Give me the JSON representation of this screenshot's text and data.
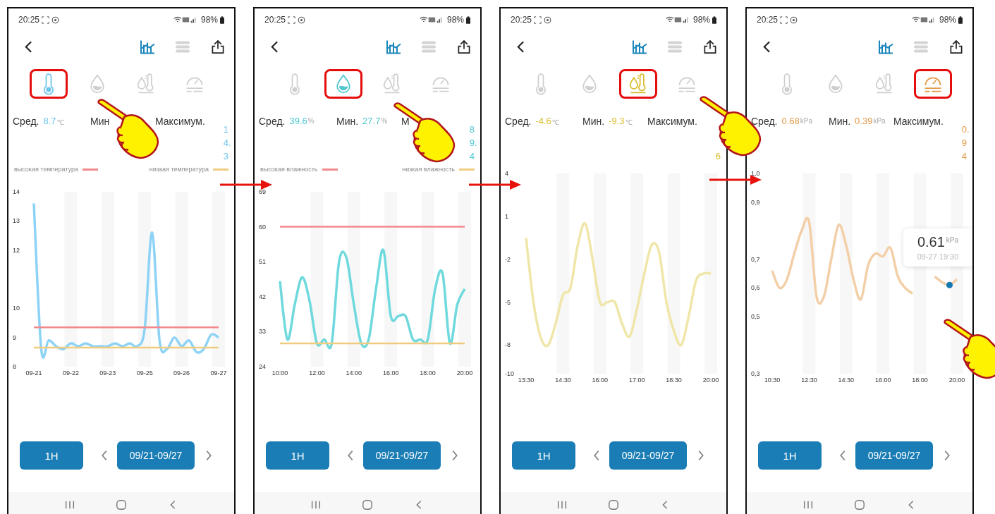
{
  "panels": [
    {
      "color": "#6cc4ec",
      "status_bar": {
        "time": "20:25",
        "battery": "98%"
      },
      "views": [
        {
          "selected": true
        },
        {
          "selected": false
        }
      ],
      "tabs": [
        {
          "selected": true
        },
        {
          "selected": false
        },
        {
          "selected": false
        },
        {
          "selected": false
        }
      ],
      "stats": [
        {
          "kind": "inline",
          "label": "Сред.",
          "value": "8.7",
          "unit": "℃"
        },
        {
          "kind": "inline",
          "label": "Мин"
        },
        {
          "kind": "column",
          "label": "Максимум.",
          "value": "14.3"
        }
      ],
      "chart_data": {
        "type": "line",
        "categories": [
          "09-21",
          null,
          null,
          null,
          null,
          "09-22",
          null,
          null,
          null,
          null,
          "09-23",
          null,
          null,
          null,
          null,
          "09-25",
          null,
          null,
          null,
          null,
          "09-26",
          null,
          null,
          null,
          null,
          "09-27"
        ],
        "yticks": [
          8,
          9,
          10,
          12,
          13,
          14
        ],
        "ylim": [
          8,
          14
        ],
        "series": [
          {
            "color": "#8dd3f6",
            "values": [
              13.6,
              8.6,
              8.9,
              8.7,
              8.6,
              8.8,
              8.7,
              8.8,
              8.7,
              8.7,
              8.7,
              8.8,
              8.7,
              8.8,
              8.7,
              9.3,
              12.6,
              8.9,
              8.6,
              9.0,
              8.7,
              8.9,
              8.5,
              8.6,
              9.1,
              9.0
            ]
          },
          {
            "name": "высокая температура",
            "color": "#f2898c",
            "values": [
              9.35,
              9.35,
              9.35,
              9.35,
              9.35,
              9.35,
              9.35,
              9.35,
              9.35,
              9.35,
              9.35,
              9.35,
              9.35,
              9.35,
              9.35,
              9.35,
              9.35,
              9.35,
              9.35,
              9.35,
              9.35,
              9.35,
              9.35,
              9.35,
              9.35,
              9.35
            ]
          },
          {
            "name": "низкая температура",
            "color": "#f0cc80",
            "values": [
              8.65,
              8.65,
              8.65,
              8.65,
              8.65,
              8.65,
              8.65,
              8.65,
              8.65,
              8.65,
              8.65,
              8.65,
              8.65,
              8.65,
              8.65,
              8.65,
              8.65,
              8.65,
              8.65,
              8.65,
              8.65,
              8.65,
              8.65,
              8.65,
              8.65,
              8.65
            ]
          }
        ]
      },
      "period_button": "1H",
      "date_range": "09/21-09/27"
    },
    {
      "color": "#4fc6cf",
      "status_bar": {
        "time": "20:25",
        "battery": "98%"
      },
      "views": [
        {
          "selected": true
        },
        {
          "selected": false
        }
      ],
      "tabs": [
        {
          "selected": false
        },
        {
          "selected": true
        },
        {
          "selected": false
        },
        {
          "selected": false
        }
      ],
      "stats": [
        {
          "kind": "inline",
          "label": "Сред.",
          "value": "39.6",
          "unit": "%"
        },
        {
          "kind": "inline",
          "label": "Мин.",
          "value": "27.7",
          "unit": "%"
        },
        {
          "kind": "column",
          "label": "М",
          "value": "89.4"
        }
      ],
      "chart_data": {
        "type": "line",
        "categories": [
          "10:00",
          null,
          null,
          null,
          null,
          "12:00",
          null,
          null,
          null,
          null,
          "14:00",
          null,
          null,
          null,
          null,
          "16:00",
          null,
          null,
          null,
          null,
          "18:00",
          null,
          null,
          null,
          null,
          "20:00"
        ],
        "yticks": [
          24,
          33,
          42,
          51,
          60,
          69
        ],
        "ylim": [
          24,
          69
        ],
        "series": [
          {
            "color": "#6fd9dd",
            "values": [
              46,
              31,
              40,
              47,
              41,
              30,
              31,
              30,
              51,
              52,
              40,
              30,
              31,
              44,
              54,
              37,
              37,
              37,
              31,
              31,
              31,
              44,
              48,
              30,
              40,
              44
            ]
          },
          {
            "name": "высокая влажность",
            "color": "#f2898c",
            "values": [
              60,
              60,
              60,
              60,
              60,
              60,
              60,
              60,
              60,
              60,
              60,
              60,
              60,
              60,
              60,
              60,
              60,
              60,
              60,
              60,
              60,
              60,
              60,
              60,
              60,
              60
            ]
          },
          {
            "name": "низкая влажность",
            "color": "#f0cc80",
            "values": [
              30,
              30,
              30,
              30,
              30,
              30,
              30,
              30,
              30,
              30,
              30,
              30,
              30,
              30,
              30,
              30,
              30,
              30,
              30,
              30,
              30,
              30,
              30,
              30,
              30,
              30
            ]
          }
        ]
      },
      "period_button": "1H",
      "date_range": "09/21-09/27"
    },
    {
      "color": "#d9bd2f",
      "status_bar": {
        "time": "20:25",
        "battery": "98%"
      },
      "views": [
        {
          "selected": true
        },
        {
          "selected": false
        }
      ],
      "tabs": [
        {
          "selected": false
        },
        {
          "selected": false
        },
        {
          "selected": true
        },
        {
          "selected": false
        }
      ],
      "stats": [
        {
          "kind": "inline",
          "label": "Сред.",
          "value": "-4.6",
          "unit": "℃"
        },
        {
          "kind": "inline",
          "label": "Мин.",
          "value": "-9.3",
          "unit": "℃"
        },
        {
          "kind": "column",
          "label": "Максимум.",
          "value": "6"
        }
      ],
      "chart_data": {
        "type": "line",
        "categories": [
          "13:30",
          null,
          null,
          null,
          null,
          "14:30",
          null,
          null,
          null,
          null,
          "16:00",
          null,
          null,
          null,
          null,
          "17:00",
          null,
          null,
          null,
          null,
          "18:30",
          null,
          null,
          null,
          null,
          "20:00"
        ],
        "yticks": [
          -10,
          -8,
          -5,
          -2,
          1,
          4
        ],
        "ylim": [
          -10,
          4
        ],
        "series": [
          {
            "color": "#efe6a8",
            "values": [
              -0.5,
              -5,
              -7.5,
              -8,
              -6.5,
              -4.5,
              -4,
              -1,
              0.5,
              -2,
              -5,
              -5,
              -5,
              -6.5,
              -7.4,
              -5.5,
              -3,
              -1,
              -1.5,
              -5,
              -7,
              -8,
              -6,
              -3.5,
              -3,
              -3
            ]
          }
        ]
      },
      "period_button": "1H",
      "date_range": "09/21-09/27"
    },
    {
      "color": "#e39a48",
      "status_bar": {
        "time": "20:25",
        "battery": "98%"
      },
      "views": [
        {
          "selected": true
        },
        {
          "selected": false
        }
      ],
      "tabs": [
        {
          "selected": false
        },
        {
          "selected": false
        },
        {
          "selected": false
        },
        {
          "selected": true
        }
      ],
      "stats": [
        {
          "kind": "inline",
          "label": "Сред.",
          "value": "0.68",
          "unit": "kPa"
        },
        {
          "kind": "inline",
          "label": "Мин.",
          "value": "0.39",
          "unit": "kPa"
        },
        {
          "kind": "column",
          "label": "Максимум.",
          "value": "0.94"
        }
      ],
      "chart_data": {
        "type": "line",
        "categories": [
          "10:30",
          null,
          null,
          null,
          null,
          "12:30",
          null,
          null,
          null,
          null,
          "14:30",
          null,
          null,
          null,
          null,
          "16:00",
          null,
          null,
          null,
          null,
          "18:00",
          null,
          null,
          null,
          null,
          "20:00"
        ],
        "yticks": [
          {
            "value": 0.3,
            "label": "0,3"
          },
          {
            "value": 0.5,
            "label": "0,5"
          },
          {
            "value": 0.6,
            "label": "0,6"
          },
          {
            "value": 0.7,
            "label": "0,7"
          },
          {
            "value": 0.9,
            "label": "0,9"
          },
          {
            "value": 1.0,
            "label": "1,0"
          }
        ],
        "ylim": [
          0.3,
          1.0
        ],
        "series": [
          {
            "color": "#f3cfa8",
            "values": [
              0.66,
              0.6,
              0.63,
              0.72,
              0.8,
              0.83,
              0.57,
              0.57,
              0.7,
              0.82,
              0.75,
              0.63,
              0.56,
              0.68,
              0.72,
              0.71,
              0.74,
              0.64,
              0.6,
              0.58,
              null,
              null,
              0.64,
              0.62,
              0.61,
              0.63
            ]
          }
        ]
      },
      "tooltip": {
        "value": "0.61",
        "unit": "kPa",
        "time": "09-27 19:30"
      },
      "period_button": "1H",
      "date_range": "09/21-09/27"
    }
  ]
}
